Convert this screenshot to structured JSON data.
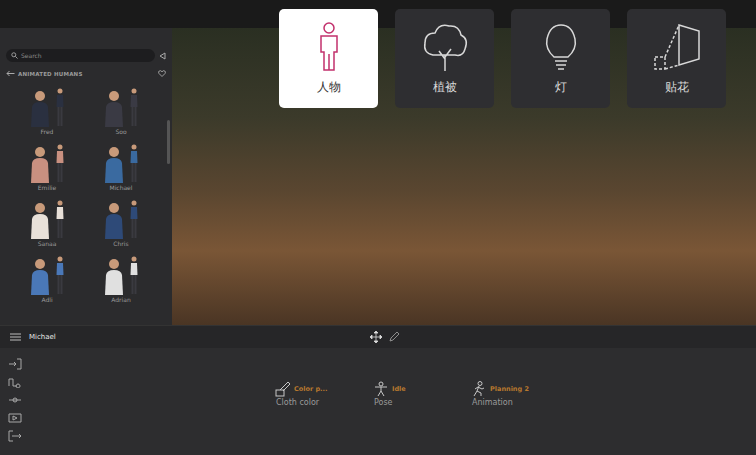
{
  "categories": [
    {
      "label": "人物",
      "selected": true
    },
    {
      "label": "植被",
      "selected": false
    },
    {
      "label": "灯",
      "selected": false
    },
    {
      "label": "贴花",
      "selected": false
    }
  ],
  "library": {
    "search": {
      "placeholder": "Search"
    },
    "section": "ANIMATED HUMANS",
    "items": [
      {
        "name": "Fred",
        "color": "#2a3040"
      },
      {
        "name": "Soo",
        "color": "#3a3a44"
      },
      {
        "name": "Emilie",
        "color": "#c99080"
      },
      {
        "name": "Michael",
        "color": "#3a6aa0"
      },
      {
        "name": "Sanaa",
        "color": "#e8e0d8"
      },
      {
        "name": "Chris",
        "color": "#2e4a78"
      },
      {
        "name": "Adli",
        "color": "#4a78b8"
      },
      {
        "name": "Adrian",
        "color": "#e0e0e0"
      }
    ]
  },
  "selection": {
    "name": "Michael"
  },
  "properties": [
    {
      "value": "Color p...",
      "label": "Cloth color"
    },
    {
      "value": "Idle",
      "label": "Pose"
    },
    {
      "value": "Planning 2",
      "label": "Animation"
    }
  ]
}
